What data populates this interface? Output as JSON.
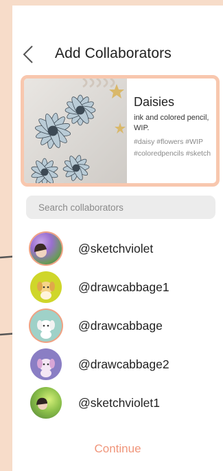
{
  "header": {
    "title": "Add Collaborators",
    "back_icon": "chevron-left-icon"
  },
  "post": {
    "title": "Daisies",
    "description": "ink and colored pencil, WIP.",
    "tags": "#daisy #flowers #WIP #coloredpencils #sketch"
  },
  "search": {
    "placeholder": "Search collaborators",
    "value": ""
  },
  "collaborators": [
    {
      "username": "@sketchviolet",
      "selected": true
    },
    {
      "username": "@drawcabbage1",
      "selected": false
    },
    {
      "username": "@drawcabbage",
      "selected": true
    },
    {
      "username": "@drawcabbage2",
      "selected": false
    },
    {
      "username": "@sketchviolet1",
      "selected": false
    }
  ],
  "continue_label": "Continue",
  "colors": {
    "accent": "#f0957a",
    "card_border": "#f8c7ae",
    "background": "#f7dcc9"
  }
}
